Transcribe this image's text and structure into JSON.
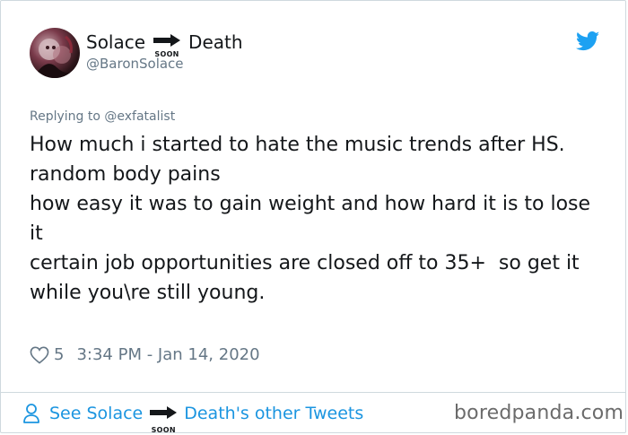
{
  "author": {
    "name_part1": "Solace",
    "arrow_label": "SOON",
    "name_part2": "Death",
    "handle": "@BaronSolace"
  },
  "reply": {
    "prefix": "Replying to",
    "mention": "@exfatalist"
  },
  "tweet": {
    "text": "How much i started to hate the music trends after HS.\nrandom body pains\nhow easy it was to gain weight and how hard it is to lose it\ncertain job opportunities are closed off to 35+  so get it while you\\re still young."
  },
  "stats": {
    "likes": "5",
    "timestamp": "3:34 PM - Jan 14, 2020"
  },
  "footer": {
    "link_prefix": "See Solace",
    "arrow_label": "SOON",
    "link_suffix": "Death's other Tweets"
  },
  "watermark": "boredpanda.com",
  "colors": {
    "twitter_blue": "#1da1f2",
    "link_blue": "#1b95e0",
    "muted_gray": "#657786"
  },
  "icons": {
    "brand": "twitter-bird-icon",
    "like": "heart-outline-icon",
    "profile": "person-outline-icon",
    "arrow": "right-arrow-soon-icon"
  }
}
